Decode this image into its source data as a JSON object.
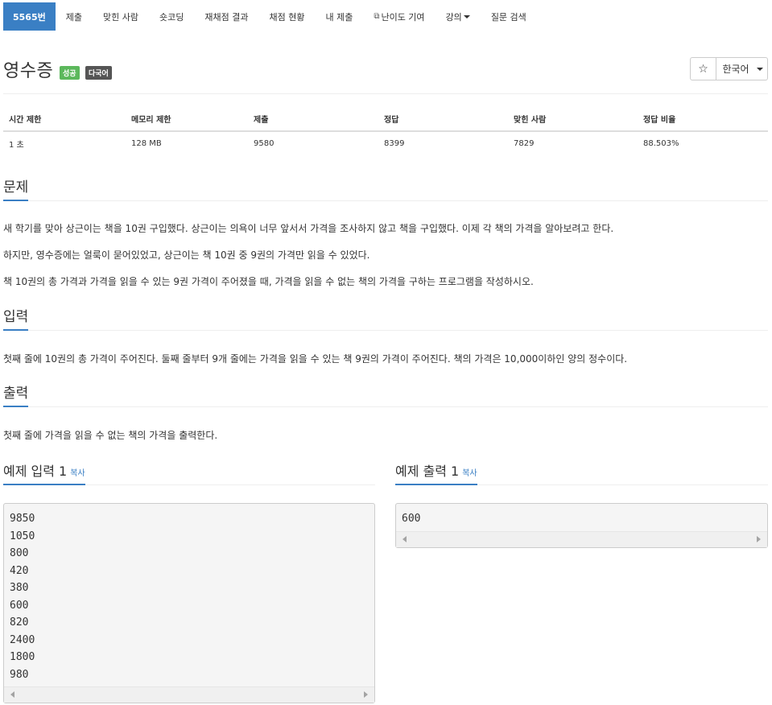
{
  "nav": {
    "items": [
      {
        "label": "5565번",
        "active": true
      },
      {
        "label": "제출"
      },
      {
        "label": "맞힌 사람"
      },
      {
        "label": "숏코딩"
      },
      {
        "label": "재채점 결과"
      },
      {
        "label": "채점 현황"
      },
      {
        "label": "내 제출"
      },
      {
        "label": "난이도 기여",
        "icon": "external-link-icon"
      },
      {
        "label": "강의",
        "dropdown": true
      },
      {
        "label": "질문 검색"
      }
    ]
  },
  "problem": {
    "title": "영수증",
    "labels": {
      "success": "성공",
      "multi_lang": "다국어"
    },
    "star": "☆",
    "language": "한국어"
  },
  "stats": {
    "headers": [
      "시간 제한",
      "메모리 제한",
      "제출",
      "정답",
      "맞힌 사람",
      "정답 비율"
    ],
    "values": [
      "1 초",
      "128 MB",
      "9580",
      "8399",
      "7829",
      "88.503%"
    ]
  },
  "sections": {
    "problem": {
      "heading": "문제",
      "paragraphs": [
        "새 학기를 맞아 상근이는 책을 10권 구입했다. 상근이는 의욕이 너무 앞서서 가격을 조사하지 않고 책을 구입했다. 이제 각 책의 가격을 알아보려고 한다.",
        "하지만, 영수증에는 얼룩이 묻어있었고, 상근이는 책 10권 중 9권의 가격만 읽을 수 있었다.",
        "책 10권의 총 가격과 가격을 읽을 수 있는 9권 가격이 주어졌을 때, 가격을 읽을 수 없는 책의 가격을 구하는 프로그램을 작성하시오."
      ]
    },
    "input": {
      "heading": "입력",
      "paragraph": "첫째 줄에 10권의 총 가격이 주어진다. 둘째 줄부터 9개 줄에는 가격을 읽을 수 있는 책 9권의 가격이 주어진다. 책의 가격은 10,000이하인 양의 정수이다."
    },
    "output": {
      "heading": "출력",
      "paragraph": "첫째 줄에 가격을 읽을 수 없는 책의 가격을 출력한다."
    }
  },
  "samples": {
    "input": {
      "heading": "예제 입력 1",
      "copy": "복사",
      "lines": [
        "9850",
        "1050",
        "800",
        "420",
        "380",
        "600",
        "820",
        "2400",
        "1800",
        "980"
      ]
    },
    "output": {
      "heading": "예제 출력 1",
      "copy": "복사",
      "lines": [
        "600"
      ]
    }
  },
  "colors": {
    "nav_active": "#3a7fc4",
    "label_success": "#5cb85c",
    "label_multi": "#555555",
    "link": "#3a7fc4"
  }
}
